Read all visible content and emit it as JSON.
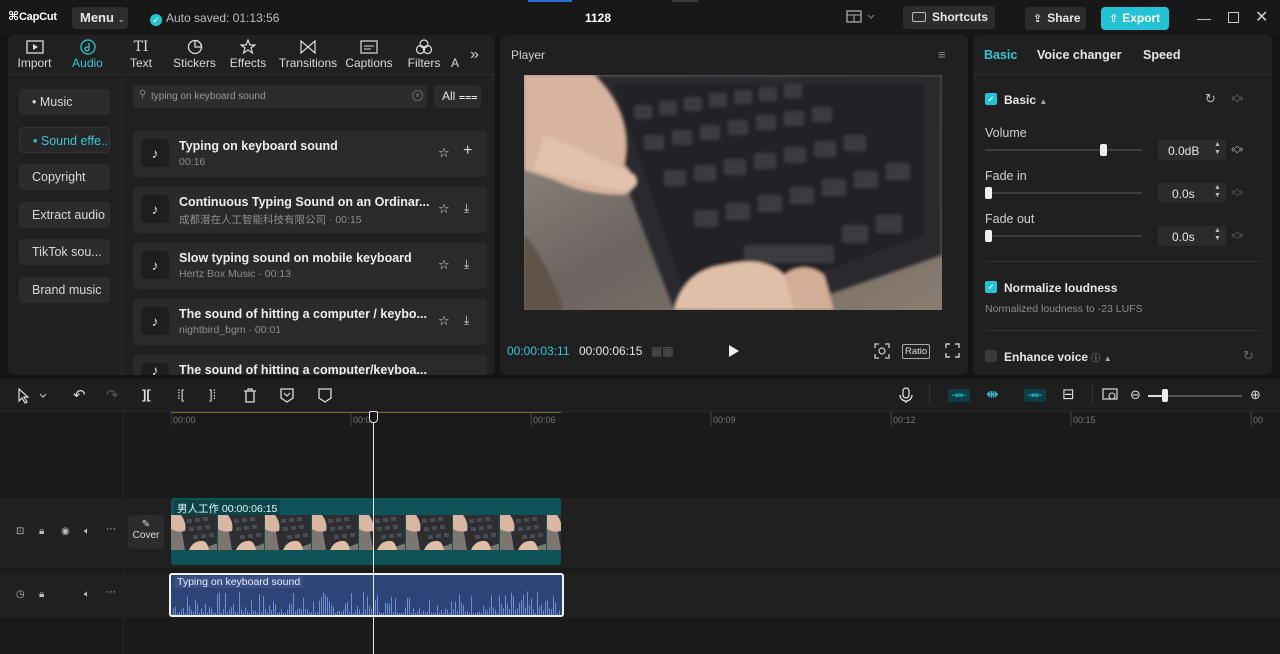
{
  "titlebar": {
    "logo": "CapCut",
    "menu": "Menu",
    "autosave": "Auto saved: 01:13:56",
    "project": "1128",
    "shortcuts": "Shortcuts",
    "share": "Share",
    "export": "Export",
    "accent": "#23c2d4"
  },
  "media_tabs": [
    {
      "label": "Import",
      "icon": "import-icon"
    },
    {
      "label": "Audio",
      "icon": "audio-icon",
      "active": true
    },
    {
      "label": "Text",
      "icon": "text-icon"
    },
    {
      "label": "Stickers",
      "icon": "stickers-icon"
    },
    {
      "label": "Effects",
      "icon": "effects-icon"
    },
    {
      "label": "Transitions",
      "icon": "transitions-icon"
    },
    {
      "label": "Captions",
      "icon": "captions-icon"
    },
    {
      "label": "Filters",
      "icon": "filters-icon"
    },
    {
      "label": "A",
      "icon": "adjust-icon"
    }
  ],
  "audio_sidebar": [
    "Music",
    "Sound effe...",
    "Copyright",
    "Extract audio",
    "TikTok sou...",
    "Brand music"
  ],
  "search": {
    "value": "typing on keyboard sound",
    "filter": "All"
  },
  "sounds": [
    {
      "title": "Typing on keyboard sound",
      "sub": "00:16"
    },
    {
      "title": "Continuous Typing Sound on an Ordinar...",
      "sub": "成都潜在人工智能科技有限公司 · 00:15"
    },
    {
      "title": "Slow typing sound on mobile keyboard",
      "sub": "Hertz Box Music · 00:13"
    },
    {
      "title": "The sound of hitting a computer / keybo...",
      "sub": "nightbird_bgm · 00:01"
    },
    {
      "title": "The sound of hitting a computer/keyboa...",
      "sub": ""
    }
  ],
  "player": {
    "title": "Player",
    "current": "00:00:03:11",
    "total": "00:00:06:15",
    "ratio": "Ratio"
  },
  "inspector": {
    "tabs": [
      "Basic",
      "Voice changer",
      "Speed"
    ],
    "basic_label": "Basic",
    "volume_label": "Volume",
    "volume_value": "0.0dB",
    "volume_level": 0.75,
    "fadein_label": "Fade in",
    "fadein_value": "0.0s",
    "fadeout_label": "Fade out",
    "fadeout_value": "0.0s",
    "normalize_label": "Normalize loudness",
    "normalize_desc": "Normalized loudness to -23 LUFS",
    "enhance_label": "Enhance voice"
  },
  "timeline": {
    "ticks": [
      "00:00",
      "00:03",
      "00:06",
      "00:09",
      "00:12",
      "00:15",
      "00"
    ],
    "video_clip_name": "男人工作",
    "video_clip_duration": "00:00:06:15",
    "audio_clip_name": "Typing on keyboard sound",
    "cover_label": "Cover"
  }
}
